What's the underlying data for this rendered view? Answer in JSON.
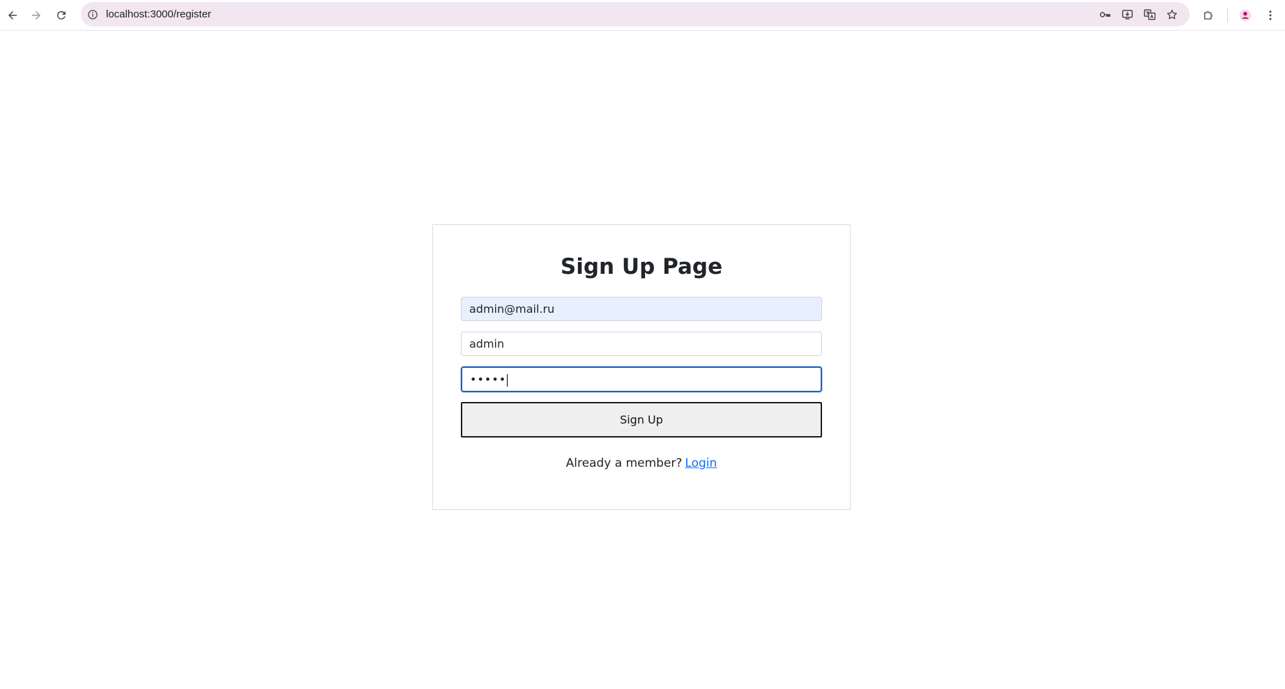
{
  "browser": {
    "url": "localhost:3000/register",
    "icons": {
      "back": "arrow-left-icon",
      "forward": "arrow-right-icon",
      "reload": "reload-icon",
      "site_info": "info-icon",
      "password_key": "key-icon",
      "install": "install-icon",
      "translate": "translate-icon",
      "bookmark": "star-icon",
      "extensions": "puzzle-icon",
      "profile": "profile-icon",
      "menu": "kebab-menu-icon"
    }
  },
  "page": {
    "title": "Sign Up Page",
    "email_value": "admin@mail.ru",
    "username_value": "admin",
    "password_value": "•••••",
    "submit_label": "Sign Up",
    "member_prompt": "Already a member?",
    "login_link": "Login"
  },
  "colors": {
    "link": "#0d6efd",
    "focus_border": "#1d5fc8",
    "autofill_bg": "#e8f0fe",
    "omnibox_bg": "#f2e6f1",
    "profile_accent": "#b0145f"
  }
}
